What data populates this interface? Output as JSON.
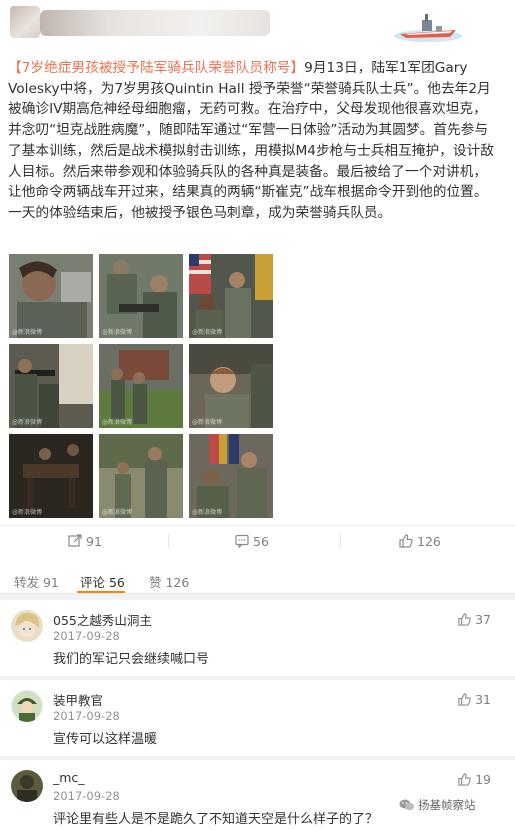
{
  "post": {
    "body": {
      "tag": "【7岁绝症男孩被授予陆军骑兵队荣誉队员称号】",
      "text": "9月13日，陆军1军团Gary Volesky中将，为7岁男孩Quintin Hall 授予荣誉“荣誉骑兵队士兵”。他去年2月被确诊IV期高危神经母细胞瘤，无药可救。在治疗中，父母发现他很喜欢坦克，并念叨“坦克战胜病魔”，随即陆军通过“军营一日体验”活动为其圆梦。首先参与了基本训练，然后是战术模拟射击训练，用模拟M4步枪与士兵相互掩护，设计敌人目标。然后来带参观和体验骑兵队的各种真是装备。最后被给了一个对讲机，让他命令两辆战车开过来，结果真的两辆“斯崔克”战车根据命令开到他的位置。一天的体验结束后，他被授予银色马刺章，成为荣誉骑兵队员。"
    },
    "photo_watermark": "@新浪微博",
    "actions": {
      "repost_count": "91",
      "comment_count": "56",
      "like_count": "126"
    }
  },
  "comments_section": {
    "tabs": {
      "repost": "转发 91",
      "comment": "评论 56",
      "like": "赞 126"
    },
    "items": [
      {
        "name": "055之越秀山洞主",
        "date": "2017-09-28",
        "text": "我们的军记只会继续喊口号",
        "likes": "37"
      },
      {
        "name": "装甲教官",
        "date": "2017-09-28",
        "text": "宣传可以这样温暖",
        "likes": "31"
      },
      {
        "name": "_mc_",
        "date": "2017-09-28",
        "text": "评论里有些人是不是跪久了不知道天空是什么样子的了？",
        "likes": "19"
      }
    ]
  },
  "watermark": {
    "label": "扬基帧察站"
  },
  "colors": {
    "topic": "#eb7350",
    "tab_active": "#ff8200"
  }
}
